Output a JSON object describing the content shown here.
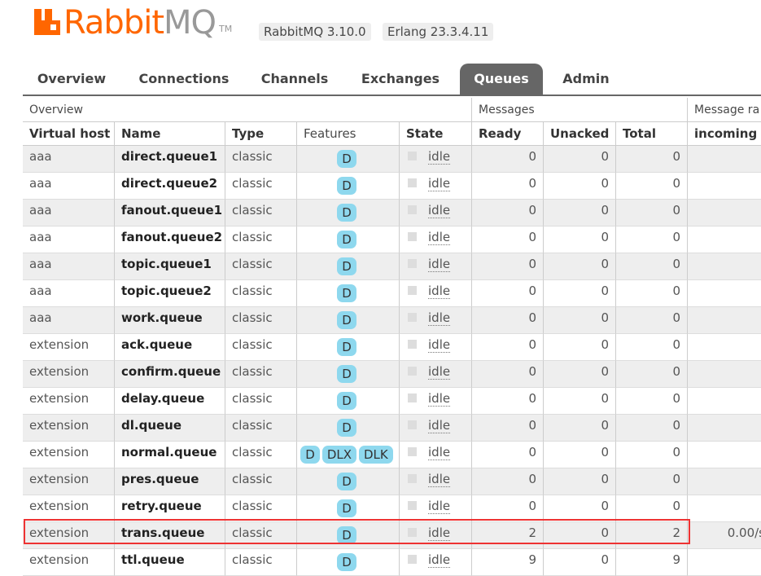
{
  "header": {
    "logo_text_rabbit": "Rabbit",
    "logo_text_mq": "MQ",
    "logo_tm": "TM",
    "rabbitmq_version": "RabbitMQ 3.10.0",
    "erlang_version": "Erlang 23.3.4.11"
  },
  "tabs": [
    {
      "label": "Overview"
    },
    {
      "label": "Connections"
    },
    {
      "label": "Channels"
    },
    {
      "label": "Exchanges"
    },
    {
      "label": "Queues"
    },
    {
      "label": "Admin"
    }
  ],
  "table": {
    "groups": {
      "overview": "Overview",
      "messages": "Messages",
      "message_rates": "Message ra"
    },
    "columns": {
      "vhost": "Virtual host",
      "name": "Name",
      "type": "Type",
      "features": "Features",
      "state": "State",
      "ready": "Ready",
      "unacked": "Unacked",
      "total": "Total",
      "incoming": "incoming"
    },
    "rows": [
      {
        "vhost": "aaa",
        "name": "direct.queue1",
        "type": "classic",
        "features": [
          "D"
        ],
        "state": "idle",
        "ready": "0",
        "unacked": "0",
        "total": "0",
        "incoming": ""
      },
      {
        "vhost": "aaa",
        "name": "direct.queue2",
        "type": "classic",
        "features": [
          "D"
        ],
        "state": "idle",
        "ready": "0",
        "unacked": "0",
        "total": "0",
        "incoming": ""
      },
      {
        "vhost": "aaa",
        "name": "fanout.queue1",
        "type": "classic",
        "features": [
          "D"
        ],
        "state": "idle",
        "ready": "0",
        "unacked": "0",
        "total": "0",
        "incoming": ""
      },
      {
        "vhost": "aaa",
        "name": "fanout.queue2",
        "type": "classic",
        "features": [
          "D"
        ],
        "state": "idle",
        "ready": "0",
        "unacked": "0",
        "total": "0",
        "incoming": ""
      },
      {
        "vhost": "aaa",
        "name": "topic.queue1",
        "type": "classic",
        "features": [
          "D"
        ],
        "state": "idle",
        "ready": "0",
        "unacked": "0",
        "total": "0",
        "incoming": ""
      },
      {
        "vhost": "aaa",
        "name": "topic.queue2",
        "type": "classic",
        "features": [
          "D"
        ],
        "state": "idle",
        "ready": "0",
        "unacked": "0",
        "total": "0",
        "incoming": ""
      },
      {
        "vhost": "aaa",
        "name": "work.queue",
        "type": "classic",
        "features": [
          "D"
        ],
        "state": "idle",
        "ready": "0",
        "unacked": "0",
        "total": "0",
        "incoming": ""
      },
      {
        "vhost": "extension",
        "name": "ack.queue",
        "type": "classic",
        "features": [
          "D"
        ],
        "state": "idle",
        "ready": "0",
        "unacked": "0",
        "total": "0",
        "incoming": ""
      },
      {
        "vhost": "extension",
        "name": "confirm.queue",
        "type": "classic",
        "features": [
          "D"
        ],
        "state": "idle",
        "ready": "0",
        "unacked": "0",
        "total": "0",
        "incoming": ""
      },
      {
        "vhost": "extension",
        "name": "delay.queue",
        "type": "classic",
        "features": [
          "D"
        ],
        "state": "idle",
        "ready": "0",
        "unacked": "0",
        "total": "0",
        "incoming": ""
      },
      {
        "vhost": "extension",
        "name": "dl.queue",
        "type": "classic",
        "features": [
          "D"
        ],
        "state": "idle",
        "ready": "0",
        "unacked": "0",
        "total": "0",
        "incoming": ""
      },
      {
        "vhost": "extension",
        "name": "normal.queue",
        "type": "classic",
        "features": [
          "D",
          "DLX",
          "DLK"
        ],
        "state": "idle",
        "ready": "0",
        "unacked": "0",
        "total": "0",
        "incoming": ""
      },
      {
        "vhost": "extension",
        "name": "pres.queue",
        "type": "classic",
        "features": [
          "D"
        ],
        "state": "idle",
        "ready": "0",
        "unacked": "0",
        "total": "0",
        "incoming": ""
      },
      {
        "vhost": "extension",
        "name": "retry.queue",
        "type": "classic",
        "features": [
          "D"
        ],
        "state": "idle",
        "ready": "0",
        "unacked": "0",
        "total": "0",
        "incoming": ""
      },
      {
        "vhost": "extension",
        "name": "trans.queue",
        "type": "classic",
        "features": [
          "D"
        ],
        "state": "idle",
        "ready": "2",
        "unacked": "0",
        "total": "2",
        "incoming": "0.00/s",
        "highlighted": true
      },
      {
        "vhost": "extension",
        "name": "ttl.queue",
        "type": "classic",
        "features": [
          "D"
        ],
        "state": "idle",
        "ready": "9",
        "unacked": "0",
        "total": "9",
        "incoming": ""
      }
    ]
  },
  "colors": {
    "brand": "#ff6600",
    "badge": "#8ed8ee",
    "active_tab": "#666666",
    "highlight_border": "#e33333"
  }
}
